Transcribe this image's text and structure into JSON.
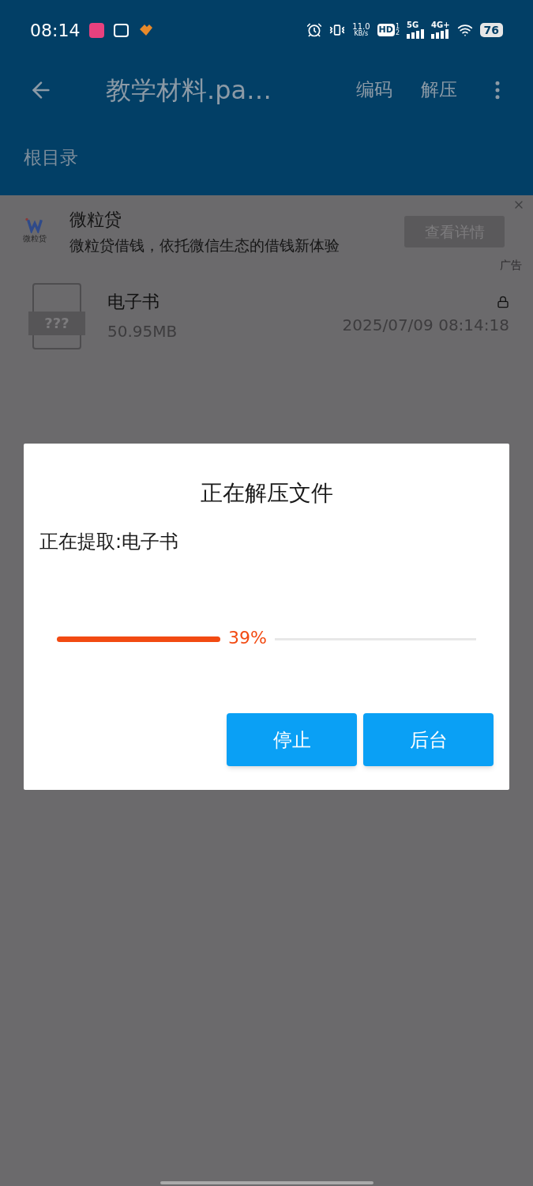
{
  "status_bar": {
    "time": "08:14",
    "net_speed": "11.0",
    "net_unit": "KB/s",
    "hd": "HD",
    "hd_sup": "1",
    "hd_sub": "2",
    "sim1": "5G",
    "sim2": "4G+",
    "battery": "76"
  },
  "toolbar": {
    "title": "教学材料.pa…",
    "actions": [
      "编码",
      "解压"
    ]
  },
  "breadcrumb": "根目录",
  "ad": {
    "logo_text": "微粒贷",
    "title": "微粒贷",
    "text": "微粒贷借钱，依托微信生态的借钱新体验",
    "button": "查看详情",
    "tag": "广告"
  },
  "files": [
    {
      "icon_text": "???",
      "name": "电子书",
      "size": "50.95MB",
      "date": "2025/07/09 08:14:18",
      "locked": true
    }
  ],
  "dialog": {
    "title": "正在解压文件",
    "message": "正在提取:电子书",
    "progress": {
      "level": 0.39,
      "reading": "39%"
    },
    "buttons": [
      "停止",
      "后台"
    ]
  }
}
